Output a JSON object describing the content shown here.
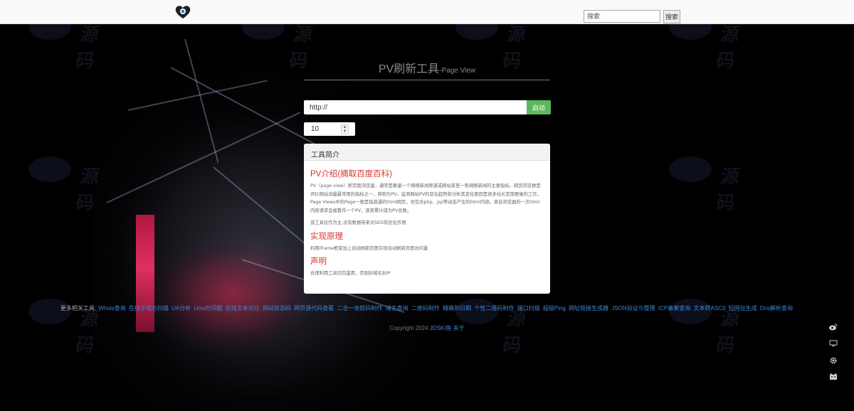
{
  "search": {
    "placeholder": "搜索",
    "button_label": "搜索"
  },
  "page": {
    "title_main": "PV刷新工具",
    "title_sub": "-Page View"
  },
  "form": {
    "url_value": "http://",
    "start_label": "启动",
    "count_value": "10"
  },
  "panel": {
    "heading": "工具简介",
    "section1_title": "PV介绍(摘取百度百科)",
    "section1_text": "PV（page view）即页面浏览量，通常是衡量一个网络新闻频道或网站甚至一条网络新闻的主要指标。网页浏览数是评价网站流量最常用的指标之一，简称为PV。监测网站PV的变化趋势和分析其变化原因是很多站长定期要做的工作。 Page Views中的Page一般是指普通的html网页，也包含php、jsp等动态产生的html内容。来自浏览器的一次html内容请求会被看作一个PV，逐渐累计成为PV总数。",
    "section1_note": "该工具仅作为主,没有数据带来对SEO有优化作用",
    "section2_title": "实现原理",
    "section2_text": "利用iframe框架加上自动刷新页面实现自动刷新页面访问量",
    "section3_title": "声明",
    "section3_text": "合理利用工具切勿滥用，否则封域名封IP"
  },
  "footer": {
    "links_prefix": "更多相关工具:",
    "links": [
      "Whois查询",
      "在线子域名扫描",
      "UA分析",
      "Unix时间戳",
      "在线文本对比",
      "网站状态码",
      "网页源代码查看",
      "二合一收款码制作",
      "域名查询",
      "二维码制作",
      "精确到日期",
      "个性二维码制作",
      "端口扫描",
      "超级Ping",
      "网址链接生成器",
      "JSON验证与整理",
      "ICP备案查询",
      "文本转ASCII",
      "短网址生成",
      "Dns解析查询"
    ],
    "copyright_text": "Copyright 2024",
    "copyright_link": "JDSKI鱼",
    "about_link": "关于"
  },
  "side_icons": [
    "weibo-icon",
    "monitor-icon",
    "gear-icon",
    "cat-icon"
  ]
}
